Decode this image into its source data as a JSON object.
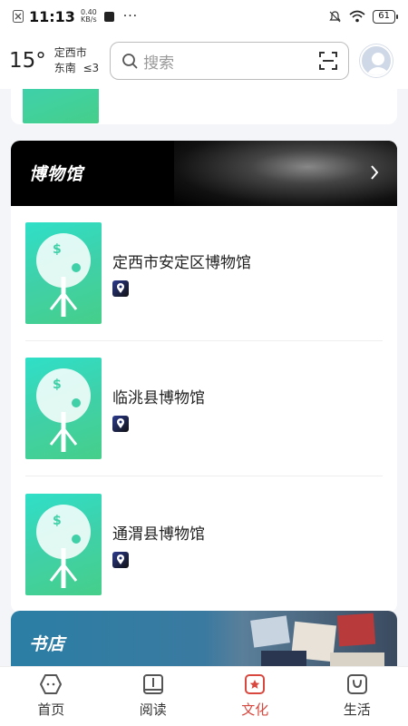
{
  "status": {
    "time": "11:13",
    "speed_value": "0.40",
    "speed_unit": "KB/s",
    "battery": "61"
  },
  "header": {
    "temperature": "15°",
    "city": "定西市",
    "wind_dir": "东南",
    "wind_level": "≤3",
    "search_placeholder": "搜索"
  },
  "sections": {
    "museum": {
      "title": "博物馆",
      "items": [
        {
          "name": "定西市安定区博物馆"
        },
        {
          "name": "临洮县博物馆"
        },
        {
          "name": "通渭县博物馆"
        }
      ]
    },
    "bookstore": {
      "title": "书店"
    }
  },
  "tabs": [
    {
      "label": "首页",
      "icon": "home-icon"
    },
    {
      "label": "阅读",
      "icon": "book-icon"
    },
    {
      "label": "文化",
      "icon": "culture-icon",
      "active": true
    },
    {
      "label": "生活",
      "icon": "bag-icon"
    }
  ],
  "colors": {
    "accent": "#d8483f",
    "thumb_gradient_start": "#2fe0c8",
    "thumb_gradient_end": "#46cf8a"
  }
}
